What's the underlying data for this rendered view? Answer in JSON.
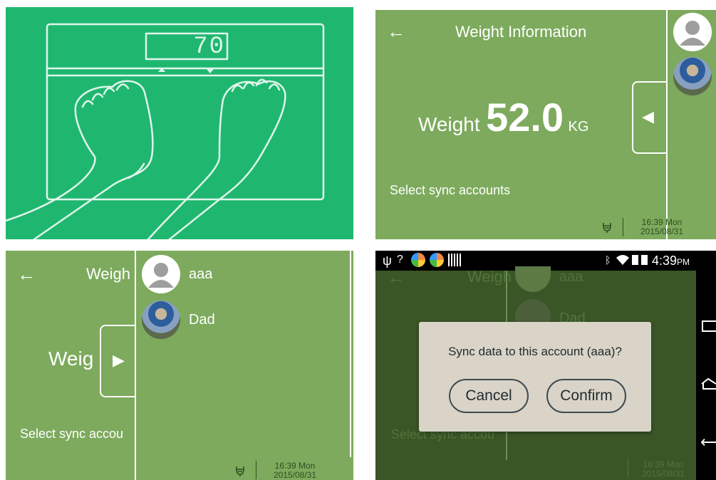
{
  "panel1": {
    "scale_display": "70"
  },
  "panel2": {
    "back_glyph": "←",
    "title": "Weight Information",
    "weight_label": "Weight",
    "weight_value": "52.0",
    "weight_unit": "KG",
    "sync_label": "Select sync accounts",
    "collapse_glyph": "◀",
    "status_time": "16:39 Mon",
    "status_date": "2015/08/31"
  },
  "panel3": {
    "back_glyph": "←",
    "title_partial": "Weigh",
    "weight_partial": "Weig",
    "sync_partial": "Select sync accou",
    "expand_glyph": "▶",
    "accounts": [
      {
        "name": "aaa"
      },
      {
        "name": "Dad"
      }
    ],
    "status_time": "16:39 Mon",
    "status_date": "2015/08/31"
  },
  "panel4": {
    "status_bar_time": "4:39",
    "status_bar_ampm": "PM",
    "bg_title_partial": "Weigh",
    "bg_account_1": "aaa",
    "bg_account_2": "Dad",
    "bg_sync_partial": "Select sync accou",
    "dialog_message": "Sync data to this account (aaa)?",
    "cancel_label": "Cancel",
    "confirm_label": "Confirm",
    "bg_status_time": "16:39 Mon",
    "bg_status_date": "2015/08/31"
  },
  "colors": {
    "scale_bg": "#1fb770",
    "app_green": "#7daa5d",
    "dim_green": "#3a5627",
    "dialog_bg": "#d9d4c7"
  }
}
